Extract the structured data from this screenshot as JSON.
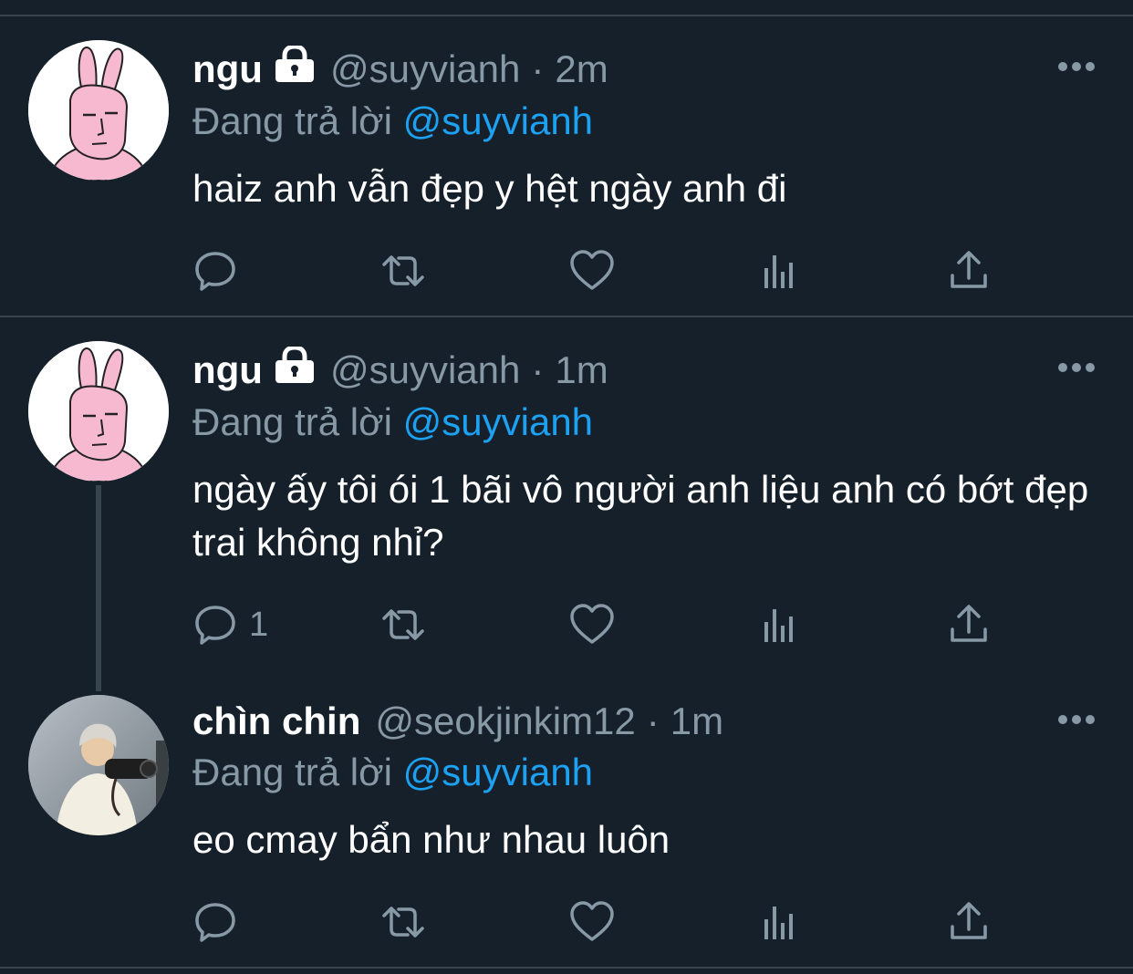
{
  "tweets": [
    {
      "name": "ngu",
      "handle": "@suyvianh",
      "separator": "·",
      "time": "2m",
      "reply_prefix": "Đang trả lời",
      "reply_to": "@suyvianh",
      "text": "haiz anh vẫn đẹp y hệt ngày anh đi",
      "reply_count": "",
      "protected": true,
      "avatar": "pink-bunny-avatar"
    },
    {
      "name": "ngu",
      "handle": "@suyvianh",
      "separator": "·",
      "time": "1m",
      "reply_prefix": "Đang trả lời",
      "reply_to": "@suyvianh",
      "text": "ngày ấy tôi ói 1 bãi vô người anh liệu anh có bớt đẹp trai không nhỉ?",
      "reply_count": "1",
      "protected": true,
      "avatar": "pink-bunny-avatar"
    },
    {
      "name": "chìn chin",
      "handle": "@seokjinkim12",
      "separator": "·",
      "time": "1m",
      "reply_prefix": "Đang trả lời",
      "reply_to": "@suyvianh",
      "text": "eo cmay bẩn như nhau luôn",
      "reply_count": "",
      "protected": false,
      "avatar": "photographer-photo-avatar"
    }
  ],
  "icons": [
    "reply-icon",
    "retweet-icon",
    "like-icon",
    "analytics-icon",
    "share-icon",
    "more-icon",
    "lock-icon"
  ],
  "colors": {
    "background": "#15202b",
    "text": "#ffffff",
    "muted": "#8899a6",
    "accent": "#1da1f2",
    "divider": "#38444d"
  }
}
